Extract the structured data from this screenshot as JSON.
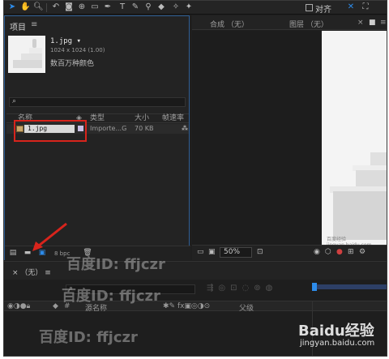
{
  "toolbar": {
    "snap_label": "对齐"
  },
  "project": {
    "title": "项目",
    "menu_icon": "≡",
    "selected_file": {
      "name": "1.jpg",
      "dimensions": "1024 x 1024 (1.00)",
      "colors": "数百万种颜色"
    },
    "columns": {
      "name": "名称",
      "type": "类型",
      "size": "大小",
      "frame_rate": "帧速率"
    },
    "rows": [
      {
        "name": "1.jpg",
        "type": "Importe...G",
        "size": "70 KB"
      }
    ],
    "bottom_bar": {
      "bpc": "8 bpc"
    }
  },
  "composition": {
    "tab_comp": "合成 （无）",
    "tab_layer": "图层 （无）",
    "zoom": "50%",
    "preview_watermark": "百度经验 jingyan.baidu.com"
  },
  "timeline": {
    "title": "（无）",
    "menu_icon": "≡",
    "col_source": "源名称",
    "col_parent": "父级"
  },
  "watermarks": {
    "baidu_id": "百度ID: ffjczr",
    "baidu_logo": "Baidu经验",
    "baidu_url": "jingyan.baidu.com"
  },
  "colors": {
    "accent": "#2d8ceb",
    "highlight_border": "#d8241c",
    "panel_bg": "#232323"
  }
}
